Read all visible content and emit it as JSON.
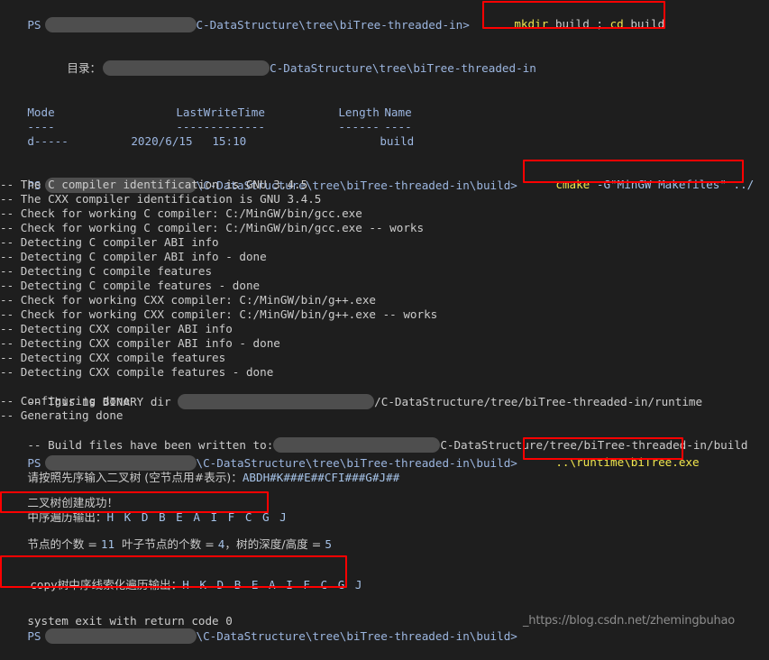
{
  "terminal": {
    "background_color": "#1e1e1e",
    "default_text_color": "#cccccc",
    "path_color": "#9cb6e0",
    "command_color": "#f2e64d",
    "highlight_box_color": "#ff0000",
    "redaction_color": "#4e4e4e"
  },
  "prompts": {
    "ps_label": "PS",
    "path1": "\\C-DataStructure\\tree\\biTree-threaded-in>",
    "path_nobs": "C-DataStructure\\tree\\biTree-threaded-in>",
    "path_build": "\\C-DataStructure\\tree\\biTree-threaded-in\\build>"
  },
  "commands": {
    "mkdir_cd": {
      "cmd1": "mkdir",
      "arg1": "build",
      "sep": ";",
      "cmd2": "cd",
      "arg2": "build"
    },
    "cmake": {
      "cmd": "cmake",
      "args": "-G\"MinGW Makefiles\" ../"
    },
    "run_exe": "..\\runtime\\biTree.exe"
  },
  "directory_listing": {
    "label": "目录：",
    "path": "C-DataStructure\\tree\\biTree-threaded-in",
    "headers": [
      "Mode",
      "LastWriteTime",
      "Length",
      "Name"
    ],
    "separators": [
      "----",
      "-------------",
      "------",
      "----"
    ],
    "rows": [
      {
        "mode": "d-----",
        "date": "2020/6/15",
        "time": "15:10",
        "length": "",
        "name": "build"
      }
    ]
  },
  "cmake_output": [
    "-- The C compiler identification is GNU 3.4.5",
    "-- The CXX compiler identification is GNU 3.4.5",
    "-- Check for working C compiler: C:/MinGW/bin/gcc.exe",
    "-- Check for working C compiler: C:/MinGW/bin/gcc.exe -- works",
    "-- Detecting C compiler ABI info",
    "-- Detecting C compiler ABI info - done",
    "-- Detecting C compile features",
    "-- Detecting C compile features - done",
    "-- Check for working CXX compiler: C:/MinGW/bin/g++.exe",
    "-- Check for working CXX compiler: C:/MinGW/bin/g++.exe -- works",
    "-- Detecting CXX compiler ABI info",
    "-- Detecting CXX compiler ABI info - done",
    "-- Detecting CXX compile features",
    "-- Detecting CXX compile features - done"
  ],
  "cmake_paths": {
    "binary_dir_prefix": "-- This is BINARY dir ",
    "binary_dir_path": "/C-DataStructure/tree/biTree-threaded-in/runtime",
    "configuring_done": "-- Configuring done",
    "generating_done": "-- Generating done",
    "build_files_prefix": "-- Build files have been written to:",
    "build_files_path": "C-DataStructure/tree/biTree-threaded-in/build"
  },
  "program_output": {
    "input_prompt": "请按照先序输入二叉树 (空节点用#表示)：",
    "input_value": "ABDH#K###E##CFI###G#J##",
    "create_success": "二叉树创建成功！",
    "inorder_label": "中序遍历输出：",
    "inorder_value": "H K D B E A I F C G J",
    "stats_node_label": "节点的个数 = ",
    "stats_node_value": "11",
    "stats_leaf_label": "  叶子节点的个数 = ",
    "stats_leaf_value": "4",
    "stats_depth_label": "，树的深度/高度 = ",
    "stats_depth_value": "5",
    "copy_label_prefix": "copy",
    "copy_label": "树中序线索化遍历输出：",
    "copy_value": "H K D B E A I F C G J",
    "exit_line": "system exit with return code 0"
  },
  "watermark": {
    "text": "_https://blog.csdn.net/zhemingbuhao"
  }
}
